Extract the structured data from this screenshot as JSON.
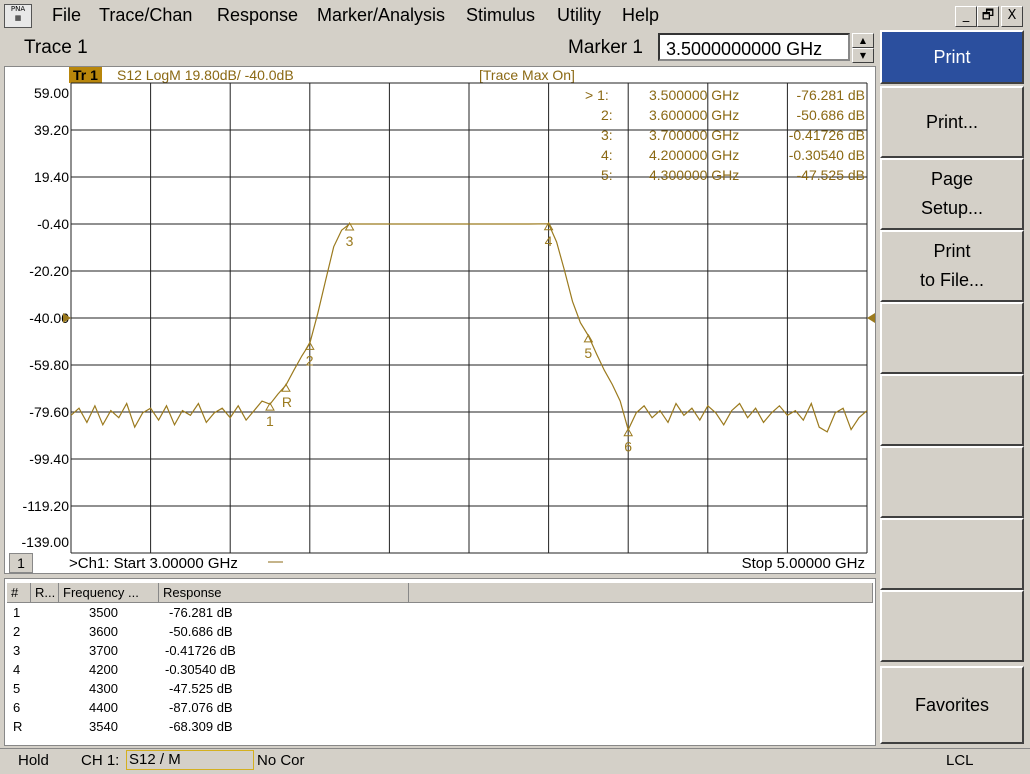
{
  "menu": {
    "app_icon_text": "PNA",
    "items": [
      "File",
      "Trace/Chan",
      "Response",
      "Marker/Analysis",
      "Stimulus",
      "Utility",
      "Help"
    ],
    "window_buttons": [
      "_",
      "🗗",
      "X"
    ]
  },
  "toolbar": {
    "trace_label": "Trace 1",
    "marker_label": "Marker 1",
    "marker_value": "3.5000000000 GHz"
  },
  "trace_header": {
    "tr_badge": "Tr  1",
    "trace_info": "S12 LogM 19.80dB/  -40.0dB",
    "trace_max": "[Trace Max On]"
  },
  "marker_readout": [
    {
      "id": "> 1:",
      "freq": "3.500000 GHz",
      "val": "-76.281 dB"
    },
    {
      "id": "2:",
      "freq": "3.600000 GHz",
      "val": "-50.686 dB"
    },
    {
      "id": "3:",
      "freq": "3.700000 GHz",
      "val": "-0.41726 dB"
    },
    {
      "id": "4:",
      "freq": "4.200000 GHz",
      "val": "-0.30540 dB"
    },
    {
      "id": "5:",
      "freq": "4.300000 GHz",
      "val": "-47.525 dB"
    }
  ],
  "y_ticks": [
    "59.00",
    "39.20",
    "19.40",
    "-0.40",
    "-20.20",
    "-40.00",
    "-59.80",
    "-79.60",
    "-99.40",
    "-119.20",
    "-139.00"
  ],
  "plot_footer": {
    "channel_num": "1",
    "start": ">Ch1: Start  3.00000 GHz",
    "stop": "Stop  5.00000 GHz"
  },
  "chart_data": {
    "type": "line",
    "title": "",
    "xlabel": "",
    "ylabel": "",
    "x_unit": "GHz",
    "y_unit": "dB",
    "xlim": [
      3.0,
      5.0
    ],
    "ylim": [
      -139.0,
      59.0
    ],
    "reference_level": -40.0,
    "grid": true,
    "series": [
      {
        "name": "S12",
        "color": "#9b7a1e",
        "x": [
          3.0,
          3.02,
          3.04,
          3.06,
          3.08,
          3.1,
          3.12,
          3.14,
          3.16,
          3.18,
          3.2,
          3.22,
          3.24,
          3.26,
          3.28,
          3.3,
          3.32,
          3.34,
          3.36,
          3.38,
          3.4,
          3.42,
          3.44,
          3.46,
          3.48,
          3.5,
          3.52,
          3.54,
          3.56,
          3.58,
          3.6,
          3.62,
          3.64,
          3.66,
          3.68,
          3.7,
          3.75,
          3.8,
          3.85,
          3.9,
          3.95,
          4.0,
          4.05,
          4.1,
          4.15,
          4.2,
          4.22,
          4.24,
          4.26,
          4.28,
          4.3,
          4.32,
          4.34,
          4.36,
          4.38,
          4.4,
          4.42,
          4.44,
          4.46,
          4.48,
          4.5,
          4.52,
          4.54,
          4.56,
          4.58,
          4.6,
          4.62,
          4.64,
          4.66,
          4.68,
          4.7,
          4.72,
          4.74,
          4.76,
          4.78,
          4.8,
          4.82,
          4.84,
          4.86,
          4.88,
          4.9,
          4.92,
          4.94,
          4.96,
          4.98,
          5.0
        ],
        "y": [
          -81,
          -78,
          -84,
          -77,
          -85,
          -79,
          -82,
          -76,
          -86,
          -80,
          -78,
          -83,
          -77,
          -85,
          -79,
          -81,
          -76,
          -84,
          -80,
          -78,
          -82,
          -77,
          -83,
          -79,
          -75,
          -76.3,
          -72,
          -68.3,
          -62,
          -56,
          -50.7,
          -38,
          -24,
          -10,
          -3,
          -0.4,
          -0.4,
          -0.4,
          -0.4,
          -0.4,
          -0.4,
          -0.4,
          -0.4,
          -0.4,
          -0.4,
          -0.3,
          -8,
          -20,
          -33,
          -42,
          -47.5,
          -55,
          -62,
          -68,
          -75,
          -87.1,
          -80,
          -77,
          -82,
          -79,
          -84,
          -76,
          -81,
          -78,
          -83,
          -77,
          -80,
          -85,
          -79,
          -76,
          -82,
          -78,
          -84,
          -80,
          -77,
          -81,
          -79,
          -83,
          -76,
          -86,
          -88,
          -80,
          -78,
          -87,
          -82,
          -79
        ]
      }
    ],
    "markers": [
      {
        "label": "1",
        "x": 3.5,
        "y": -76.281
      },
      {
        "label": "2",
        "x": 3.6,
        "y": -50.686
      },
      {
        "label": "3",
        "x": 3.7,
        "y": -0.41726
      },
      {
        "label": "4",
        "x": 4.2,
        "y": -0.3054
      },
      {
        "label": "5",
        "x": 4.3,
        "y": -47.525
      },
      {
        "label": "6",
        "x": 4.4,
        "y": -87.076
      },
      {
        "label": "R",
        "x": 3.54,
        "y": -68.309
      }
    ]
  },
  "table": {
    "headers": [
      "#",
      "R...",
      "Frequency ...",
      "Response"
    ],
    "rows": [
      {
        "id": "1",
        "freq": "3500",
        "resp": "-76.281 dB"
      },
      {
        "id": "2",
        "freq": "3600",
        "resp": "-50.686 dB"
      },
      {
        "id": "3",
        "freq": "3700",
        "resp": "-0.41726 dB"
      },
      {
        "id": "4",
        "freq": "4200",
        "resp": "-0.30540 dB"
      },
      {
        "id": "5",
        "freq": "4300",
        "resp": "-47.525 dB"
      },
      {
        "id": "6",
        "freq": "4400",
        "resp": "-87.076 dB"
      },
      {
        "id": "R",
        "freq": "3540",
        "resp": "-68.309 dB"
      }
    ]
  },
  "softkeys": {
    "print": "Print",
    "print_dialog": "Print...",
    "page_setup_1": "Page",
    "page_setup_2": "Setup...",
    "print_file_1": "Print",
    "print_file_2": "to File...",
    "favorites": "Favorites"
  },
  "status": {
    "hold": "Hold",
    "ch": "CH 1:",
    "meas": "S12 / M",
    "cor": "No Cor",
    "lcl": "LCL"
  },
  "colors": {
    "trace": "#9b7a1e",
    "active_softkey": "#2b4f9e",
    "chrome": "#d4d0c8"
  }
}
